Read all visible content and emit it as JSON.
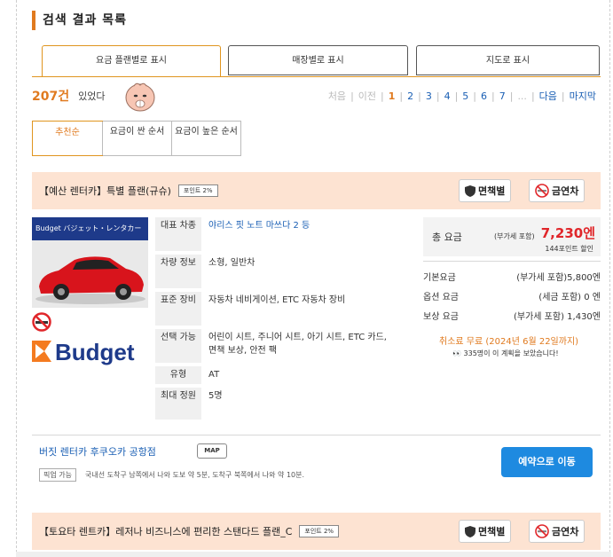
{
  "page_title": "검색 결과 목록",
  "tabs": [
    {
      "label": "요금 플랜별로 표시",
      "active": true
    },
    {
      "label": "매장별로 표시",
      "active": false
    },
    {
      "label": "지도로 표시",
      "active": false
    }
  ],
  "result": {
    "count": "207건",
    "suffix": "있었다"
  },
  "pager": {
    "first": "처음",
    "prev": "이전",
    "pages": [
      "1",
      "2",
      "3",
      "4",
      "5",
      "6",
      "7",
      "..."
    ],
    "current": "1",
    "next": "다음",
    "last": "마지막"
  },
  "sort": [
    {
      "label": "추천순",
      "active": true
    },
    {
      "label": "요금이 싼 순서",
      "active": false
    },
    {
      "label": "요금이 높은 순서",
      "active": false
    }
  ],
  "plans": [
    {
      "name": "【예산 렌터카】특별 플랜(규슈)",
      "point_badge": "포인트 2%",
      "insurance_btn": "면책별",
      "smoking_btn": "금연차",
      "photo_banner": "Budget バジェット・レンタカー",
      "brand_logo": "Budget",
      "specs": [
        {
          "label": "대표 차종",
          "value": "야리스 핏 노트 마쓰다 2 등"
        },
        {
          "label": "차량 정보",
          "value": "소형, 일반차"
        },
        {
          "label": "표준 장비",
          "value": "자동차 네비게이션, ETC 자동차 장비"
        },
        {
          "label": "선택 가능",
          "value": "어린이 시트, 주니어 시트, 아기 시트, ETC 카드, 면책 보상, 안전 팩"
        },
        {
          "label": "유형",
          "value": "AT"
        },
        {
          "label": "최대 정원",
          "value": "5명"
        }
      ],
      "total_label": "총 요금",
      "total_tax": "(부가세 포함)",
      "total_price": "7,230엔",
      "points": "144포인트 할인",
      "fees": [
        {
          "label": "기본요금",
          "value": "(부가세 포함)5,800엔"
        },
        {
          "label": "옵션 요금",
          "value": "(세금 포함) 0 엔"
        },
        {
          "label": "보상 요금",
          "value": "(부가세 포함) 1,430엔"
        }
      ],
      "cancel": "취소료 무료 (2024년 6월 22일까지)",
      "views": "335명이 이 계획을 보았습니다!",
      "shop": "버짓 렌터카 후쿠오카 공항점",
      "map_btn": "MAP",
      "pickup_badge": "픽업 가능",
      "pickup_text": "국내선 도착구 남쪽에서 나와 도보 약 5분, 도착구 북쪽에서 나와 약 10분.",
      "reserve_btn": "예약으로 이동"
    },
    {
      "name": "【토요타 렌트카】레저나 비즈니스에 편리한 스탠다드 플랜_C",
      "point_badge": "포인트 2%",
      "insurance_btn": "면책별",
      "smoking_btn": "금연차"
    }
  ]
}
